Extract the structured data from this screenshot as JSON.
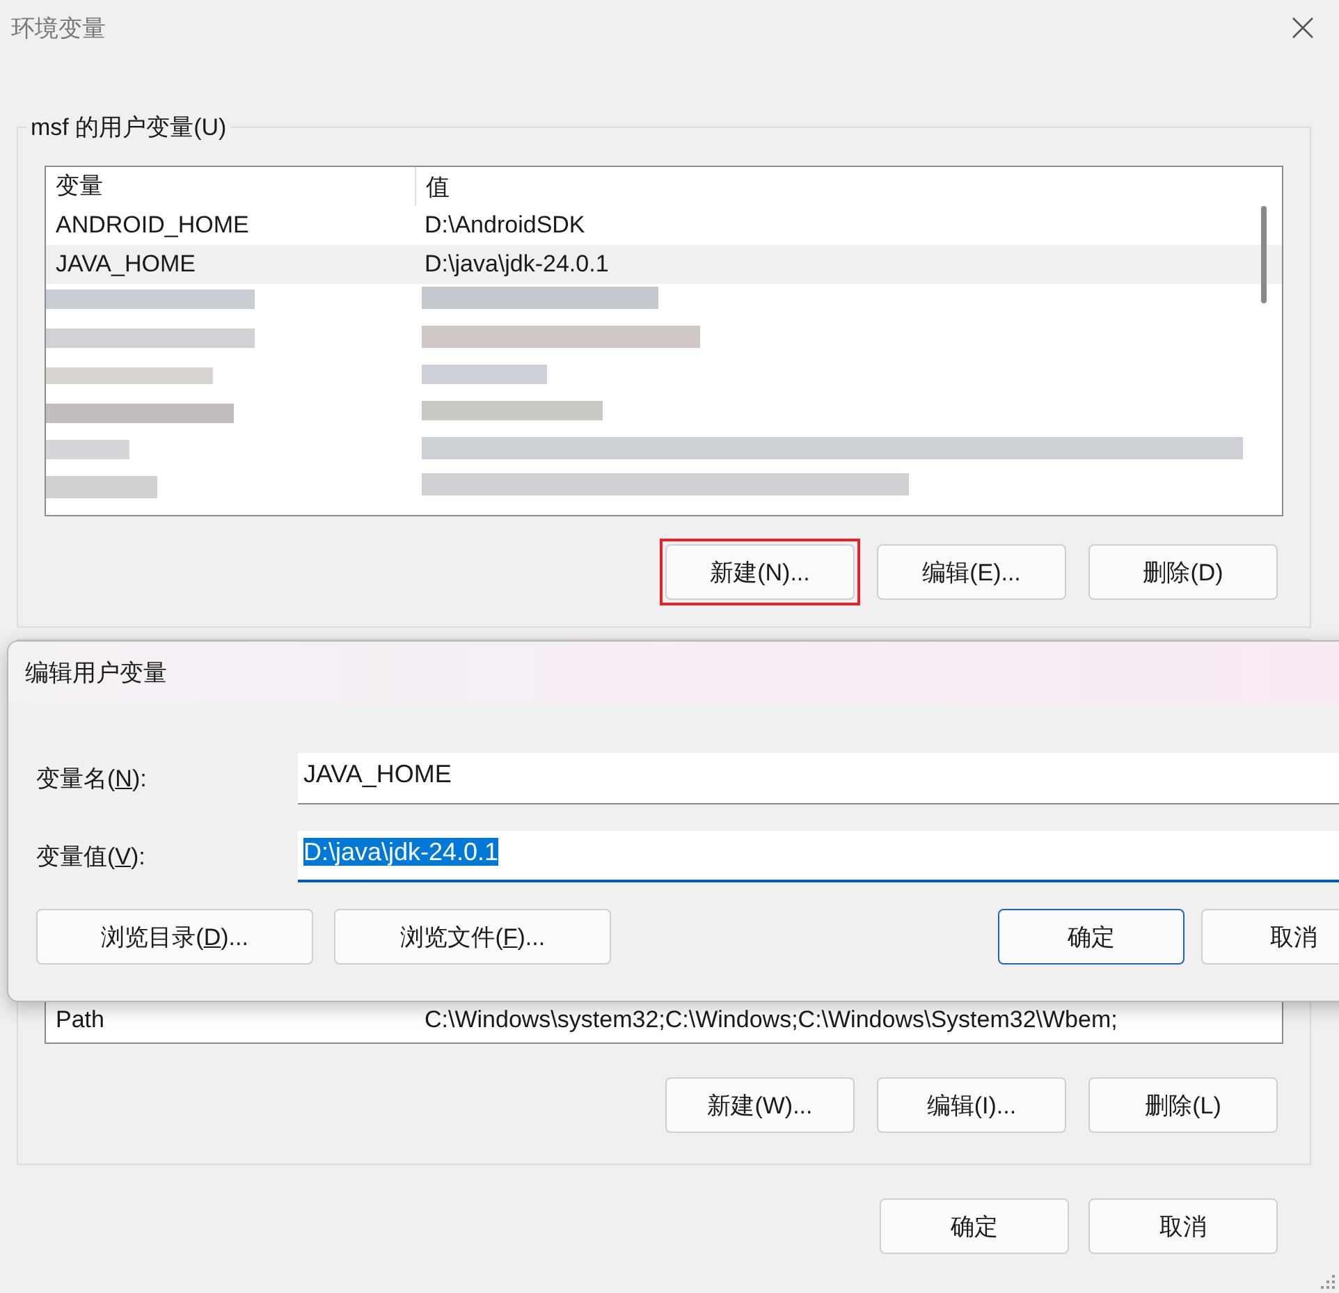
{
  "window": {
    "title": "环境变量"
  },
  "user_vars": {
    "legend": "msf 的用户变量(U)",
    "columns": [
      "变量",
      "值"
    ],
    "rows": [
      {
        "name": "ANDROID_HOME",
        "value": "D:\\AndroidSDK",
        "selected": false
      },
      {
        "name": "JAVA_HOME",
        "value": "D:\\java\\jdk-24.0.1",
        "selected": true
      }
    ],
    "buttons": [
      {
        "label": "新建(N)...",
        "highlighted": true
      },
      {
        "label": "编辑(E)...",
        "highlighted": false
      },
      {
        "label": "删除(D)",
        "highlighted": false
      }
    ]
  },
  "system_vars": {
    "rows": [
      {
        "name": "Path",
        "value": "C:\\Windows\\system32;C:\\Windows;C:\\Windows\\System32\\Wbem;"
      }
    ],
    "buttons": [
      "新建(W)...",
      "编辑(I)...",
      "删除(L)"
    ]
  },
  "buttons": [
    "确定",
    "取消"
  ],
  "dialog": {
    "title": "编辑用户变量",
    "fields": [
      {
        "label": {
          "before": "变量名(",
          "key": "N",
          "after": "):"
        },
        "value": "JAVA_HOME",
        "focused": false,
        "text_selected": false
      },
      {
        "label": {
          "before": "变量值(",
          "key": "V",
          "after": "):"
        },
        "value": "D:\\java\\jdk-24.0.1",
        "focused": true,
        "text_selected": true
      }
    ],
    "buttons": [
      {
        "label": {
          "before": "浏览目录(",
          "key": "D",
          "after": ")..."
        },
        "default": false
      },
      {
        "label": {
          "before": "浏览文件(",
          "key": "F",
          "after": ")..."
        },
        "default": false
      },
      {
        "label": {
          "before": "确定"
        },
        "default": true
      },
      {
        "label": {
          "before": "取消"
        },
        "default": false
      }
    ]
  }
}
